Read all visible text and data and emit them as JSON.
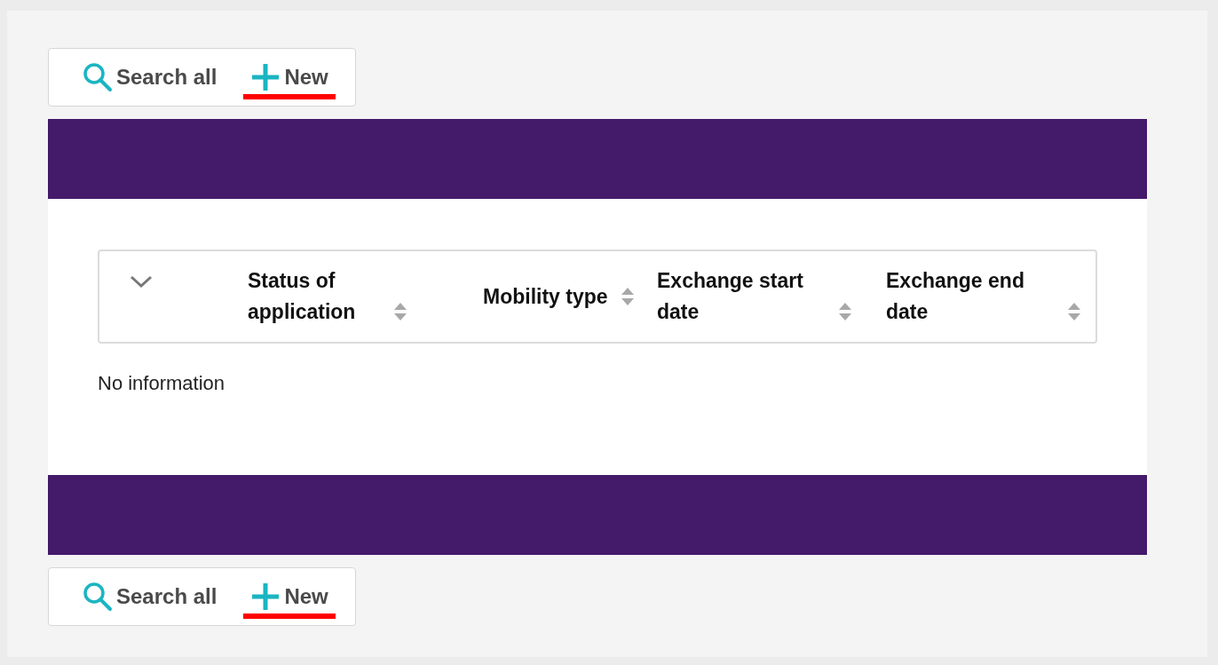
{
  "top_toolbar": {
    "buttons": [
      {
        "kind": "search",
        "label": "Search all",
        "highlighted": false
      },
      {
        "kind": "add",
        "label": "New",
        "highlighted": true
      }
    ]
  },
  "table": {
    "columns": [
      {
        "label": "Status of application",
        "sortable": true
      },
      {
        "label": "Mobility type",
        "sortable": true
      },
      {
        "label": "Exchange start date",
        "sortable": true
      },
      {
        "label": "Exchange end date",
        "sortable": true
      }
    ],
    "empty_message": "No information"
  },
  "bottom_toolbar": {
    "buttons": [
      {
        "kind": "search",
        "label": "Search all",
        "highlighted": false
      },
      {
        "kind": "add",
        "label": "New",
        "highlighted": true
      }
    ]
  }
}
